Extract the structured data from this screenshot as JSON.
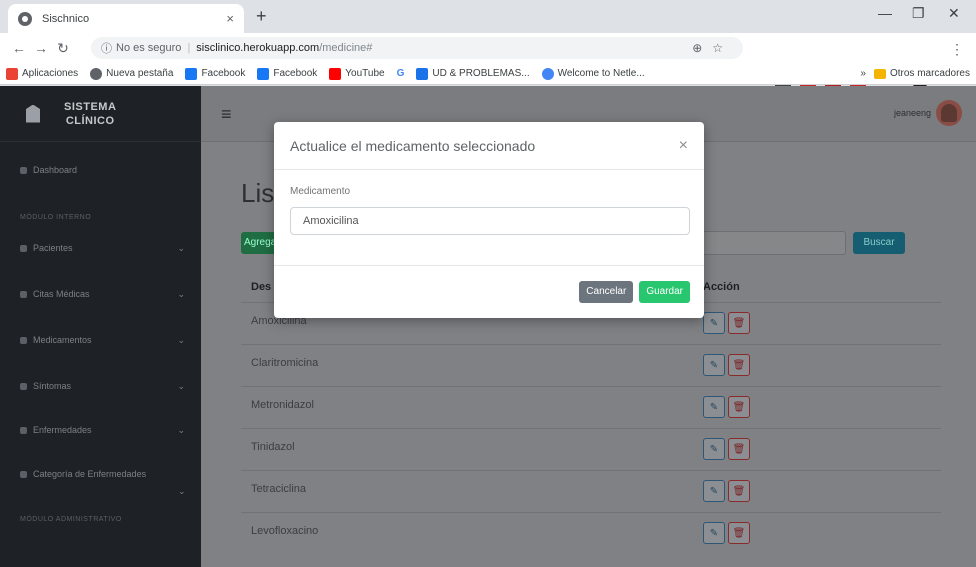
{
  "browser": {
    "tab_title": "Sischnico",
    "tab_close": "×",
    "new_tab": "+",
    "not_secure": "No es seguro",
    "url_host": "sisclinico.herokuapp.com",
    "url_path": "/medicine#",
    "bookmarks": [
      {
        "label": "Aplicaciones",
        "color": "#ea4335"
      },
      {
        "label": "Nueva pestaña",
        "color": "#5f6368"
      },
      {
        "label": "Facebook",
        "color": "#1877f2"
      },
      {
        "label": "Facebook",
        "color": "#1877f2"
      },
      {
        "label": "YouTube",
        "color": "#ff0000"
      },
      {
        "label": "G",
        "color": "#ffffff"
      },
      {
        "label": "UD & PROBLEMAS...",
        "color": "#1a73e8"
      },
      {
        "label": "Welcome to Netle...",
        "color": "#4285f4"
      }
    ],
    "other_bookmarks": "Otros marcadores",
    "more_bookmarks": "»"
  },
  "sidebar": {
    "brand_line1": "SISTEMA",
    "brand_line2": "CLÍNICO",
    "dashboard": "Dashboard",
    "section1": "MÓDULO INTERNO",
    "items": [
      {
        "label": "Pacientes"
      },
      {
        "label": "Citas Médicas"
      },
      {
        "label": "Medicamentos"
      },
      {
        "label": "Síntomas"
      },
      {
        "label": "Enfermedades"
      },
      {
        "label": "Categoría de Enfermedades"
      }
    ],
    "section2": "MÓDULO ADMINISTRATIVO"
  },
  "topnav": {
    "menu_icon": "≡",
    "username": "jeaneeng"
  },
  "main": {
    "heading": "Lis",
    "add_button": "Agregar",
    "search_button": "Buscar",
    "col_name": "Des",
    "col_action": "Acción",
    "rows": [
      {
        "name": "Amoxicilina"
      },
      {
        "name": "Claritromicina"
      },
      {
        "name": "Metronidazol"
      },
      {
        "name": "Tinidazol"
      },
      {
        "name": "Tetraciclina"
      },
      {
        "name": "Levofloxacino"
      }
    ]
  },
  "modal": {
    "title": "Actualice el medicamento seleccionado",
    "close": "×",
    "field_label": "Medicamento",
    "field_value": "Amoxicilina",
    "cancel_label": "Cancelar",
    "save_label": "Guardar"
  },
  "colors": {
    "sidebar_bg": "#1e2226",
    "save_green": "#28c76f",
    "cancel_gray": "#6c757d",
    "edit_blue": "#2f5675",
    "delete_red": "#8a2a2a"
  }
}
